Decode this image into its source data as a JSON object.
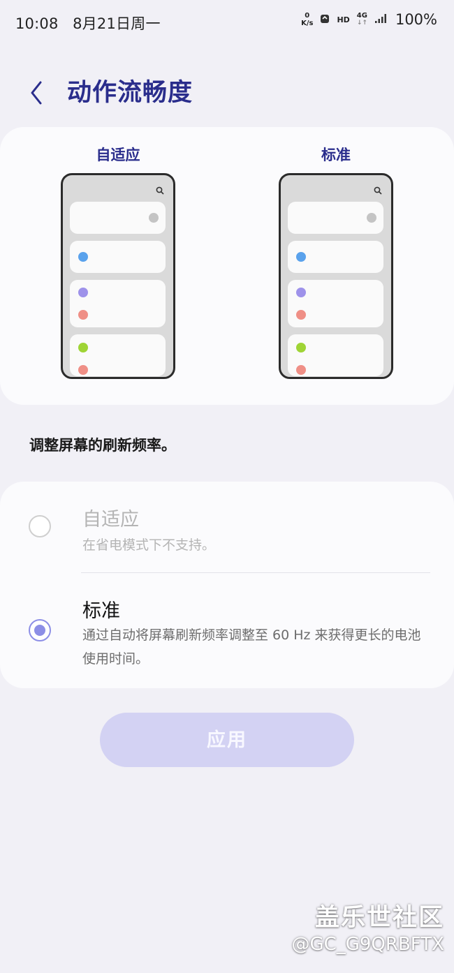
{
  "status_bar": {
    "time": "10:08",
    "date": "8月21日周一",
    "net_speed_value": "0",
    "net_speed_unit": "K/s",
    "hd": "HD",
    "network": "4G",
    "battery": "100%"
  },
  "header": {
    "title": "动作流畅度"
  },
  "preview": {
    "adaptive_label": "自适应",
    "standard_label": "标准",
    "dot_colors": [
      "#c4c4c4",
      "#5aa2ec",
      "#9e92ea",
      "#ef8f86",
      "#9fd435",
      "#ef8f86"
    ]
  },
  "description": "调整屏幕的刷新频率。",
  "options": [
    {
      "title": "自适应",
      "subtitle": "在省电模式下不支持。",
      "selected": false,
      "enabled": false
    },
    {
      "title": "标准",
      "subtitle": "通过自动将屏幕刷新频率调整至 60 Hz 来获得更长的电池使用时间。",
      "selected": true,
      "enabled": true
    }
  ],
  "apply_button": "应用",
  "watermark": {
    "brand": "盖乐世社区",
    "user": "@GC_G9QRBFTX"
  },
  "colors": {
    "accent": "#2a2d8c",
    "radio_selected": "#8c8ee6",
    "apply_bg": "#d3d2f3",
    "page_bg": "#f1f0f6"
  }
}
